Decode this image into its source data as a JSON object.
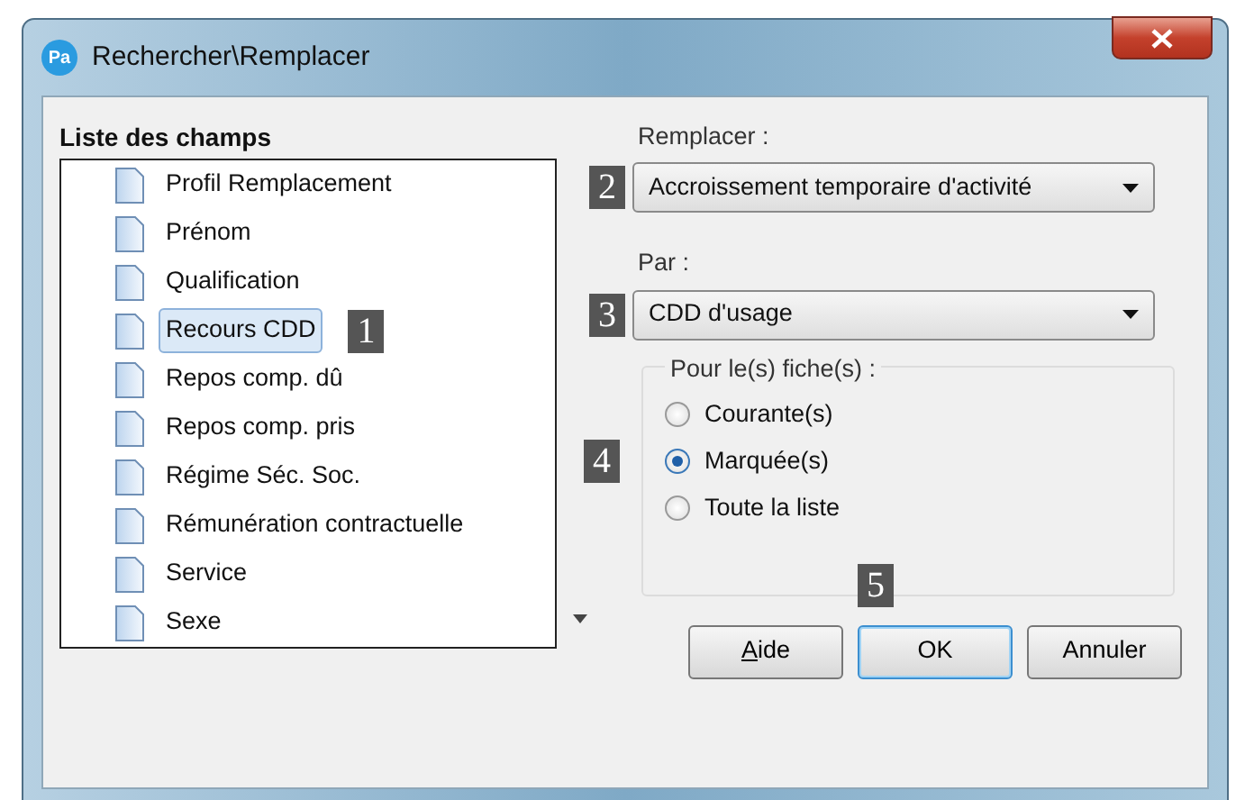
{
  "window": {
    "title": "Rechercher\\Remplacer",
    "app_icon": "Pa"
  },
  "fields_list": {
    "label": "Liste des champs",
    "items": [
      {
        "label": "Profil Remplacement",
        "selected": false
      },
      {
        "label": "Prénom",
        "selected": false
      },
      {
        "label": "Qualification",
        "selected": false
      },
      {
        "label": "Recours CDD",
        "selected": true,
        "callout": "1"
      },
      {
        "label": "Repos comp. dû",
        "selected": false
      },
      {
        "label": "Repos comp. pris",
        "selected": false
      },
      {
        "label": "Régime Séc. Soc.",
        "selected": false
      },
      {
        "label": "Rémunération contractuelle",
        "selected": false
      },
      {
        "label": "Service",
        "selected": false
      },
      {
        "label": "Sexe",
        "selected": false
      }
    ]
  },
  "replace": {
    "label": "Remplacer :",
    "value": "Accroissement temporaire d'activité",
    "callout": "2"
  },
  "with": {
    "label": "Par :",
    "value": "CDD d'usage",
    "callout": "3"
  },
  "scope": {
    "label": "Pour le(s) fiche(s) :",
    "options": [
      {
        "label": "Courante(s)",
        "selected": false
      },
      {
        "label": "Marquée(s)",
        "selected": true,
        "callout": "4"
      },
      {
        "label": "Toute la liste",
        "selected": false
      }
    ]
  },
  "buttons": [
    {
      "label": "Aide",
      "underline_first": true,
      "default": false
    },
    {
      "label": "OK",
      "underline_first": false,
      "default": true,
      "callout": "5"
    },
    {
      "label": "Annuler",
      "underline_first": false,
      "default": false
    }
  ]
}
